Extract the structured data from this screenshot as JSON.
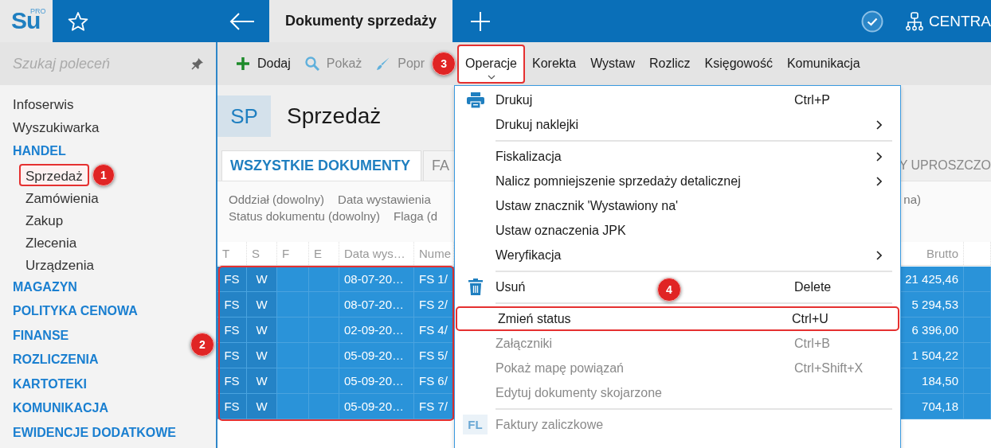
{
  "header": {
    "logo": {
      "text": "Su",
      "superscript": "PRO"
    },
    "tab_title": "Dokumenty sprzedaży",
    "company": "CENTRA"
  },
  "sidebar": {
    "search_placeholder": "Szukaj poleceń",
    "items": [
      {
        "label": "Infoserwis",
        "kind": "link"
      },
      {
        "label": "Wyszukiwarka",
        "kind": "link"
      },
      {
        "label": "HANDEL",
        "kind": "section",
        "children": [
          {
            "label": "Sprzedaż",
            "selected": true,
            "marker": "1"
          },
          {
            "label": "Zamówienia",
            "selected": false
          },
          {
            "label": "Zakup",
            "selected": false
          },
          {
            "label": "Zlecenia",
            "selected": false
          },
          {
            "label": "Urządzenia",
            "selected": false
          }
        ]
      },
      {
        "label": "MAGAZYN",
        "kind": "section"
      },
      {
        "label": "POLITYKA CENOWA",
        "kind": "section"
      },
      {
        "label": "FINANSE",
        "kind": "section"
      },
      {
        "label": "ROZLICZENIA",
        "kind": "section"
      },
      {
        "label": "KARTOTEKI",
        "kind": "section"
      },
      {
        "label": "KOMUNIKACJA",
        "kind": "section"
      },
      {
        "label": "EWIDENCJE DODATKOWE",
        "kind": "section"
      }
    ]
  },
  "toolbar": [
    {
      "label": "Dodaj",
      "disabled": false,
      "open": false
    },
    {
      "label": "Pokaż",
      "disabled": true,
      "open": false
    },
    {
      "label": "Popr",
      "disabled": true,
      "open": false,
      "marker": "3"
    },
    {
      "label": "Operacje",
      "disabled": false,
      "open": true
    },
    {
      "label": "Korekta",
      "disabled": false,
      "open": false
    },
    {
      "label": "Wystaw",
      "disabled": false,
      "open": false
    },
    {
      "label": "Rozlicz",
      "disabled": false,
      "open": false
    },
    {
      "label": "Księgowość",
      "disabled": false,
      "open": false
    },
    {
      "label": "Komunikacja",
      "disabled": false,
      "open": false
    }
  ],
  "page": {
    "code": "SP",
    "title": "Sprzedaż"
  },
  "tabs": [
    {
      "label": "WSZYSTKIE DOKUMENTY",
      "selected": true
    },
    {
      "label": "FA",
      "selected": false
    },
    {
      "label": "Y UPROSZCZO",
      "selected": false
    }
  ],
  "filters": {
    "rows": [
      [
        "Oddział (dowolny)",
        "Data wystawienia"
      ],
      [
        "Status dokumentu (dowolny)",
        "Flaga (d"
      ]
    ],
    "right": "na)"
  },
  "table": {
    "columns": [
      "T",
      "S",
      "F",
      "E",
      "Data wys…",
      "Nume"
    ],
    "right_columns": [
      "Brutto"
    ],
    "marker": "2",
    "rows": [
      {
        "type": "FS",
        "status": "W",
        "date": "08-07-20…",
        "number": "FS 1/",
        "gross": "21 425,46",
        "selected": true
      },
      {
        "type": "FS",
        "status": "W",
        "date": "08-07-20…",
        "number": "FS 2/",
        "gross": "5 294,53",
        "selected": true
      },
      {
        "type": "FS",
        "status": "W",
        "date": "02-09-20…",
        "number": "FS 4/",
        "gross": "6 396,00",
        "selected": true
      },
      {
        "type": "FS",
        "status": "W",
        "date": "05-09-20…",
        "number": "FS 5/",
        "gross": "1 504,22",
        "selected": true
      },
      {
        "type": "FS",
        "status": "W",
        "date": "05-09-20…",
        "number": "FS 6/",
        "gross": "184,50",
        "selected": true
      },
      {
        "type": "FS",
        "status": "W",
        "date": "05-09-20…",
        "number": "FS 7/",
        "gross": "704,18",
        "selected": true
      }
    ]
  },
  "menu": {
    "items": [
      {
        "kind": "item",
        "label": "Drukuj",
        "shortcut": "Ctrl+P",
        "disabled": false
      },
      {
        "kind": "submenu",
        "label": "Drukuj naklejki",
        "disabled": false
      },
      {
        "kind": "separator"
      },
      {
        "kind": "submenu",
        "label": "Fiskalizacja",
        "disabled": false
      },
      {
        "kind": "submenu",
        "label": "Nalicz pomniejszenie sprzedaży detalicznej",
        "disabled": false
      },
      {
        "kind": "item",
        "label": "Ustaw znacznik 'Wystawiony na'",
        "disabled": false
      },
      {
        "kind": "item",
        "label": "Ustaw oznaczenia JPK",
        "disabled": false
      },
      {
        "kind": "submenu",
        "label": "Weryfikacja",
        "disabled": false
      },
      {
        "kind": "separator"
      },
      {
        "kind": "item",
        "label": "Usuń",
        "shortcut": "Delete",
        "disabled": false
      },
      {
        "kind": "separator"
      },
      {
        "kind": "item",
        "label": "Zmień status",
        "shortcut": "Ctrl+U",
        "disabled": false,
        "marker": "4"
      },
      {
        "kind": "item",
        "label": "Załączniki",
        "shortcut": "Ctrl+B",
        "disabled": true
      },
      {
        "kind": "item",
        "label": "Pokaż mapę powiązań",
        "shortcut": "Ctrl+Shift+X",
        "disabled": true
      },
      {
        "kind": "item",
        "label": "Edytuj dokumenty skojarzone",
        "disabled": true
      },
      {
        "kind": "separator"
      },
      {
        "kind": "item",
        "label": "Faktury zaliczkowe",
        "icon_text": "FL",
        "disabled": true
      }
    ]
  }
}
